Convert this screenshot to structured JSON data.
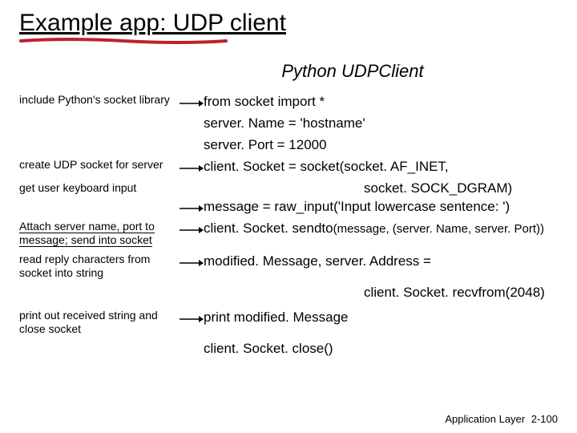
{
  "title": "Example app: UDP client",
  "subtitle": "Python UDPClient",
  "annotations": {
    "a1": "include Python's socket library",
    "a2": "create UDP socket for server",
    "a3": "get user keyboard input",
    "a4": "Attach server name, port to message; send into socket",
    "a5": "read reply characters from socket into string",
    "a6": "print out received string and close socket"
  },
  "code": {
    "c1": "from socket import *",
    "c2": "server. Name = 'hostname'",
    "c3": "server. Port = 12000",
    "c4": "client. Socket = socket(socket. AF_INET,",
    "c4b": "socket. SOCK_DGRAM)",
    "c5": "message = raw_input('Input lowercase sentence: ')",
    "c6a": "client. Socket. sendto",
    "c6b": "(message, (server. Name, server. Port))",
    "c7": "modified. Message, server. Address =",
    "c7b": "client. Socket. recvfrom(2048)",
    "c8": "print modified. Message",
    "c9": "client. Socket. close()"
  },
  "footer": {
    "label": "Application Layer",
    "page": "2-100"
  },
  "colors": {
    "accent_red": "#C0202E"
  }
}
